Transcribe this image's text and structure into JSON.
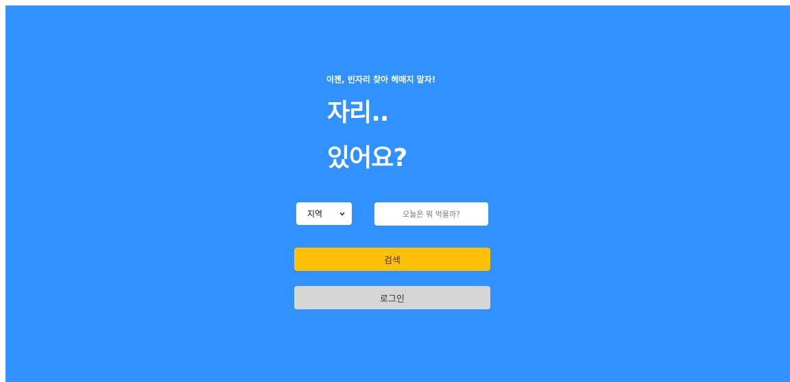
{
  "hero": {
    "tagline": "이젠, 빈자리 찾아 헤매지 말자!",
    "headline_line1": "자리..",
    "headline_line2": "있어요?"
  },
  "search": {
    "region_select_value": "지역",
    "region_chevron_icon": "chevron-down-icon",
    "menu_input_placeholder": "오늘은 뭐 먹을까?",
    "menu_input_value": "",
    "search_button_label": "검색",
    "login_button_label": "로그인"
  },
  "colors": {
    "background": "#3091ff",
    "search_button": "#ffc107",
    "login_button": "#d6d6d6",
    "text_light": "#ffffff"
  }
}
